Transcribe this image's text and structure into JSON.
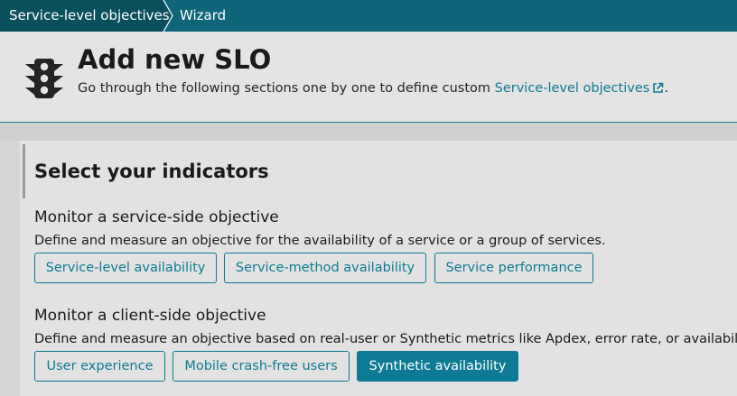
{
  "breadcrumb": {
    "items": [
      {
        "label": "Service-level objectives"
      },
      {
        "label": "Wizard"
      }
    ]
  },
  "header": {
    "icon": "traffic-light-icon",
    "title": "Add new SLO",
    "description_prefix": "Go through the following sections one by one to define custom ",
    "link_text": "Service-level objectives",
    "link_icon": "external-link-icon",
    "description_suffix": "."
  },
  "card": {
    "title": "Select your indicators",
    "sections": [
      {
        "heading": "Monitor a service-side objective",
        "description": "Define and measure an objective for the availability of a service or a group of services.",
        "buttons": [
          {
            "label": "Service-level availability"
          },
          {
            "label": "Service-method availability"
          },
          {
            "label": "Service performance"
          }
        ]
      },
      {
        "heading": "Monitor a client-side objective",
        "description": "Define and measure an objective based on real-user or Synthetic metrics like Apdex, error rate, or availability.",
        "buttons": [
          {
            "label": "User experience"
          },
          {
            "label": "Mobile crash-free users"
          },
          {
            "label": "Synthetic availability",
            "selected": true
          }
        ]
      }
    ]
  },
  "colors": {
    "accent": "#0c7b93",
    "breadcrumb_bg": "#0f6679",
    "breadcrumb_active_bg": "#0a4f5e"
  }
}
